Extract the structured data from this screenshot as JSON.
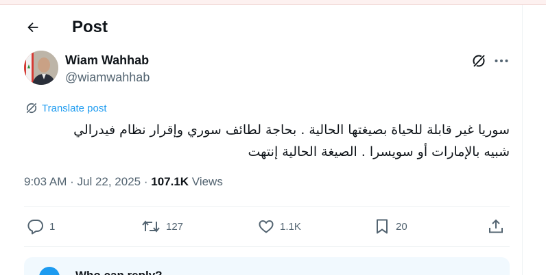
{
  "header": {
    "title": "Post"
  },
  "author": {
    "display_name": "Wiam Wahhab",
    "handle": "@wiamwahhab"
  },
  "translate_label": "Translate post",
  "tweet": {
    "line1": "سوريا غير قابلة للحياة بصيغتها الحالية . بحاجة لطائف سوري وإقرار نظام فيدرالي",
    "line2": "شبيه بالإمارات أو سويسرا . الصيغة الحالية إنتهت"
  },
  "meta": {
    "time": "9:03 AM",
    "separator": " · ",
    "date": "Jul 22, 2025",
    "views_count": "107.1K",
    "views_label": " Views"
  },
  "actions": {
    "replies": "1",
    "reposts": "127",
    "likes": "1.1K",
    "bookmarks": "20"
  },
  "reply_settings": {
    "title": "Who can reply?"
  },
  "colors": {
    "accent": "#1d9bf0",
    "text": "#0f1419",
    "muted": "#536471",
    "border": "#eff3f4"
  }
}
